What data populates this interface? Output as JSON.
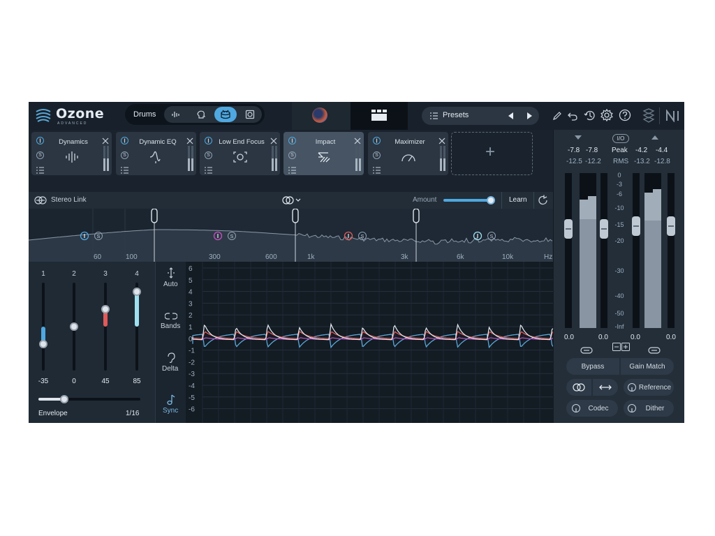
{
  "app": {
    "name": "Ozone",
    "edition": "ADVANCED"
  },
  "assistant": {
    "selected_instrument": "Drums"
  },
  "presets": {
    "label": "Presets"
  },
  "modules": [
    {
      "name": "Dynamics"
    },
    {
      "name": "Dynamic EQ"
    },
    {
      "name": "Low End Focus"
    },
    {
      "name": "Impact"
    },
    {
      "name": "Maximizer"
    }
  ],
  "module_badge": "S",
  "add_module": "+",
  "spectrum": {
    "stereo_link": "Stereo Link",
    "amount_label": "Amount",
    "amount": 0.92,
    "learn": "Learn",
    "freq_labels": [
      "60",
      "100",
      "300",
      "600",
      "1k",
      "3k",
      "6k",
      "10k",
      "Hz"
    ]
  },
  "bands": [
    {
      "num": "1",
      "value": "-35",
      "color": "#4fa8e0",
      "level": 0.3
    },
    {
      "num": "2",
      "value": "0",
      "color": "#c94cc2",
      "level": 0.5
    },
    {
      "num": "3",
      "value": "45",
      "color": "#e05a5a",
      "level": 0.7
    },
    {
      "num": "4",
      "value": "85",
      "color": "#9fe0ee",
      "level": 0.9
    }
  ],
  "envelope": {
    "label": "Envelope",
    "value": "1/16",
    "level": 0.25
  },
  "side_tools": [
    {
      "label": "Auto",
      "icon": "auto-icon"
    },
    {
      "label": "Bands",
      "icon": "bands-icon"
    },
    {
      "label": "Delta",
      "icon": "delta-icon"
    },
    {
      "label": "Sync",
      "icon": "sync-icon"
    }
  ],
  "graph": {
    "y_labels": [
      "6",
      "5",
      "4",
      "3",
      "2",
      "1",
      "0",
      "-1",
      "-2",
      "-3",
      "-4",
      "-5",
      "-6"
    ]
  },
  "meters": {
    "in_peak": [
      "-7.8",
      "-7.8"
    ],
    "in_rms": [
      "-12.5",
      "-12.2"
    ],
    "out_peak": [
      "-4.2",
      "-4.4"
    ],
    "out_rms": [
      "-13.2",
      "-12.8"
    ],
    "peak_label": "Peak",
    "rms_label": "RMS",
    "io_label": "I/O",
    "scale": [
      "0",
      "-3",
      "-6",
      "-10",
      "-15",
      "-20",
      "-30",
      "-40",
      "-50",
      "-Inf"
    ],
    "in_gain": [
      "0.0",
      "0.0"
    ],
    "out_gain": [
      "0.0",
      "0.0"
    ]
  },
  "footer": {
    "bypass": "Bypass",
    "gain_match": "Gain Match",
    "reference": "Reference",
    "codec": "Codec",
    "dither": "Dither"
  },
  "colors": {
    "accent": "#4fa8e0",
    "panel": "#1d2733",
    "red": "#e05a5a"
  }
}
